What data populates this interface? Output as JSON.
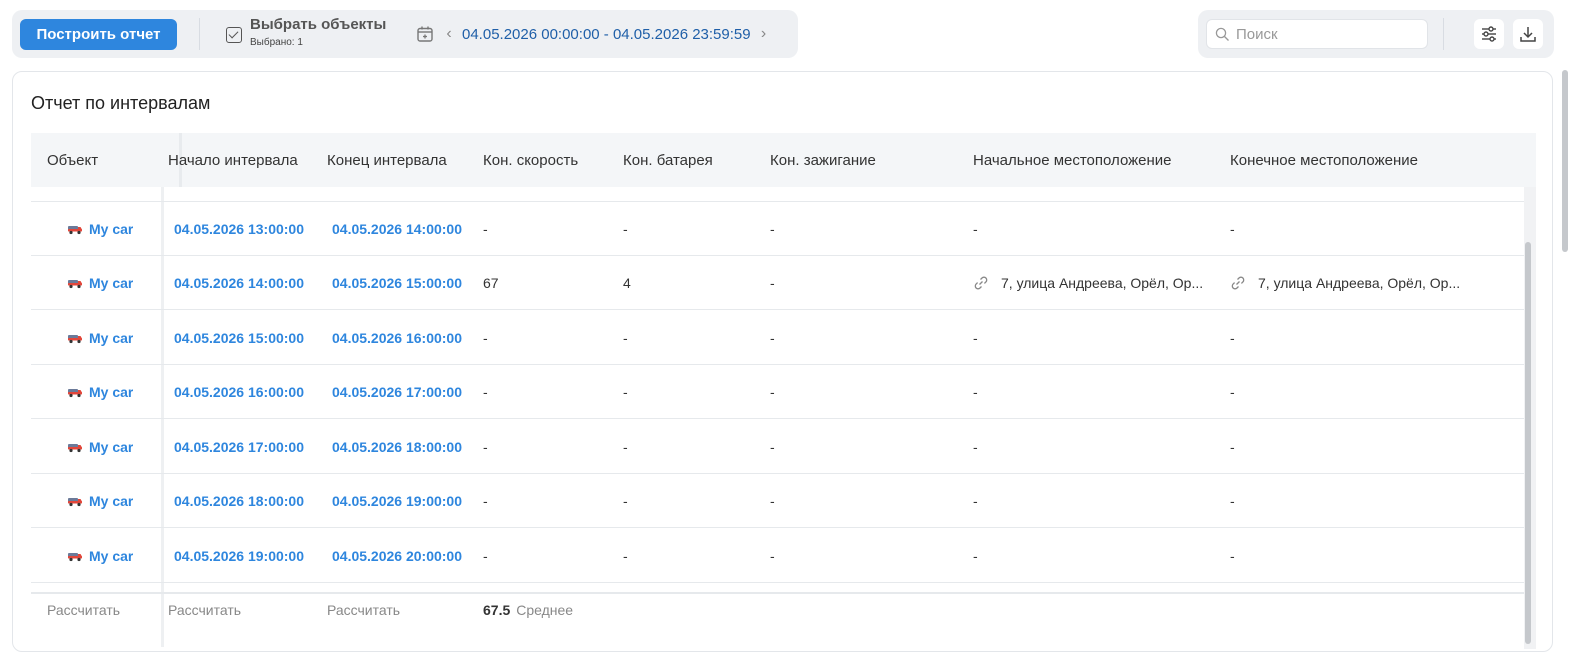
{
  "toolbar": {
    "build_label": "Построить отчет",
    "select_label": "Выбрать объекты",
    "selected_count": "Выбрано: 1",
    "date_range": "04.05.2026 00:00:00 - 04.05.2026 23:59:59",
    "search_placeholder": "Поиск"
  },
  "report": {
    "title": "Отчет по интервалам",
    "columns": [
      "Объект",
      "Начало интервала",
      "Конец интервала",
      "Кон. скорость",
      "Кон. батарея",
      "Кон. зажигание",
      "Начальное местоположение",
      "Конечное местоположение"
    ],
    "rows": [
      {
        "object": "My car",
        "start": "04.05.2026 13:00:00",
        "end": "04.05.2026 14:00:00",
        "speed": "-",
        "battery": "-",
        "ignition": "-",
        "start_loc": "-",
        "end_loc": "-"
      },
      {
        "object": "My car",
        "start": "04.05.2026 14:00:00",
        "end": "04.05.2026 15:00:00",
        "speed": "67",
        "battery": "4",
        "ignition": "-",
        "start_loc": "7, улица Андреева, Орёл, Ор...",
        "end_loc": "7, улица Андреева, Орёл, Ор..."
      },
      {
        "object": "My car",
        "start": "04.05.2026 15:00:00",
        "end": "04.05.2026 16:00:00",
        "speed": "-",
        "battery": "-",
        "ignition": "-",
        "start_loc": "-",
        "end_loc": "-"
      },
      {
        "object": "My car",
        "start": "04.05.2026 16:00:00",
        "end": "04.05.2026 17:00:00",
        "speed": "-",
        "battery": "-",
        "ignition": "-",
        "start_loc": "-",
        "end_loc": "-"
      },
      {
        "object": "My car",
        "start": "04.05.2026 17:00:00",
        "end": "04.05.2026 18:00:00",
        "speed": "-",
        "battery": "-",
        "ignition": "-",
        "start_loc": "-",
        "end_loc": "-"
      },
      {
        "object": "My car",
        "start": "04.05.2026 18:00:00",
        "end": "04.05.2026 19:00:00",
        "speed": "-",
        "battery": "-",
        "ignition": "-",
        "start_loc": "-",
        "end_loc": "-"
      },
      {
        "object": "My car",
        "start": "04.05.2026 19:00:00",
        "end": "04.05.2026 20:00:00",
        "speed": "-",
        "battery": "-",
        "ignition": "-",
        "start_loc": "-",
        "end_loc": "-"
      }
    ],
    "footer": {
      "calc_label": "Рассчитать",
      "speed_value": "67.5",
      "speed_label": "Среднее"
    }
  },
  "colors": {
    "accent": "#2e86de",
    "date_text": "#1f5fa8"
  },
  "icons": {
    "calendar": "calendar-icon",
    "search": "search-icon",
    "settings": "sliders-icon",
    "download": "download-icon",
    "car": "car-icon",
    "link": "link-icon"
  }
}
